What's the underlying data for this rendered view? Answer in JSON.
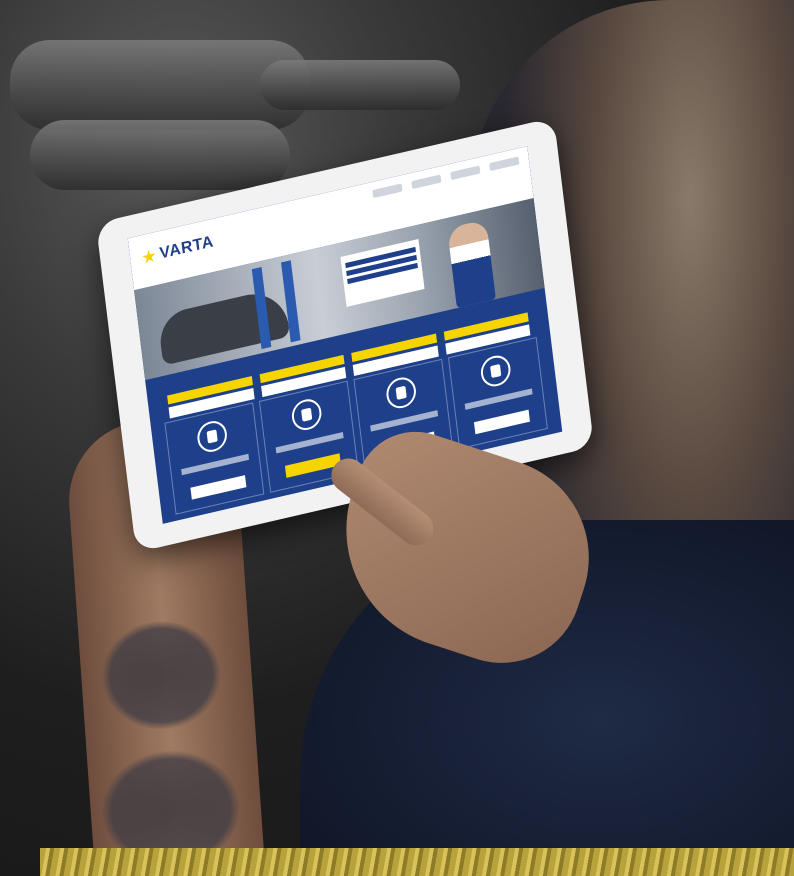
{
  "scene": {
    "description_tags": [
      "mechanic-hands",
      "tablet",
      "engine-bay",
      "tattooed-arm"
    ]
  },
  "tablet_screen": {
    "brand": "VARTA",
    "accent_colors": {
      "brand_blue": "#1e3f8a",
      "brand_yellow": "#f5d400"
    },
    "feature_count": 4,
    "selector_count": 4
  }
}
